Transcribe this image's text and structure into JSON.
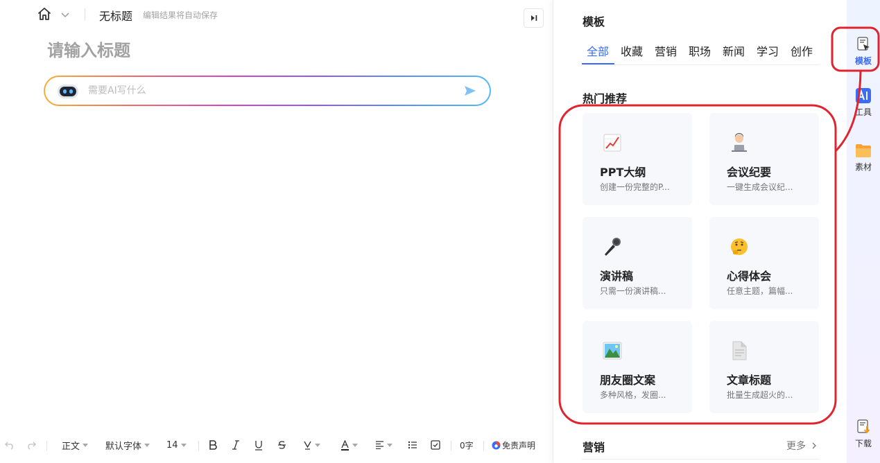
{
  "header": {
    "doc_name": "无标题",
    "autosave": "编辑结果将自动保存"
  },
  "editor": {
    "title_placeholder": "请输入标题",
    "ai_placeholder": "需要AI写什么"
  },
  "toolbar": {
    "paragraph": "正文",
    "font": "默认字体",
    "size": "14",
    "word_count": "0字",
    "disclaimer": "免责声明"
  },
  "panel": {
    "title": "模板",
    "tabs": [
      {
        "label": "全部",
        "active": true
      },
      {
        "label": "收藏"
      },
      {
        "label": "营销"
      },
      {
        "label": "职场"
      },
      {
        "label": "新闻"
      },
      {
        "label": "学习"
      },
      {
        "label": "创作"
      }
    ],
    "hot_title": "热门推荐",
    "cards": [
      {
        "icon": "chart-icon",
        "title": "PPT大纲",
        "desc": "创建一份完整的P..."
      },
      {
        "icon": "laptop-person-icon",
        "title": "会议纪要",
        "desc": "一键生成会议纪..."
      },
      {
        "icon": "microphone-icon",
        "title": "演讲稿",
        "desc": "只需一份演讲稿..."
      },
      {
        "icon": "thinking-face-icon",
        "title": "心得体会",
        "desc": "任意主题，篇幅..."
      },
      {
        "icon": "landscape-photo-icon",
        "title": "朋友圈文案",
        "desc": "多种风格，发圈..."
      },
      {
        "icon": "document-icon",
        "title": "文章标题",
        "desc": "批量生成超火的..."
      }
    ],
    "marketing_title": "营销",
    "more": "更多"
  },
  "sidebar": {
    "items": [
      {
        "label": "模板",
        "icon": "template-icon",
        "active": true
      },
      {
        "label": "工具",
        "icon": "ai-tools-icon"
      },
      {
        "label": "素材",
        "icon": "folder-icon"
      },
      {
        "label": "下载",
        "icon": "download-icon"
      }
    ]
  },
  "colors": {
    "accent": "#3b6cf7",
    "annotation": "#e0242f"
  }
}
